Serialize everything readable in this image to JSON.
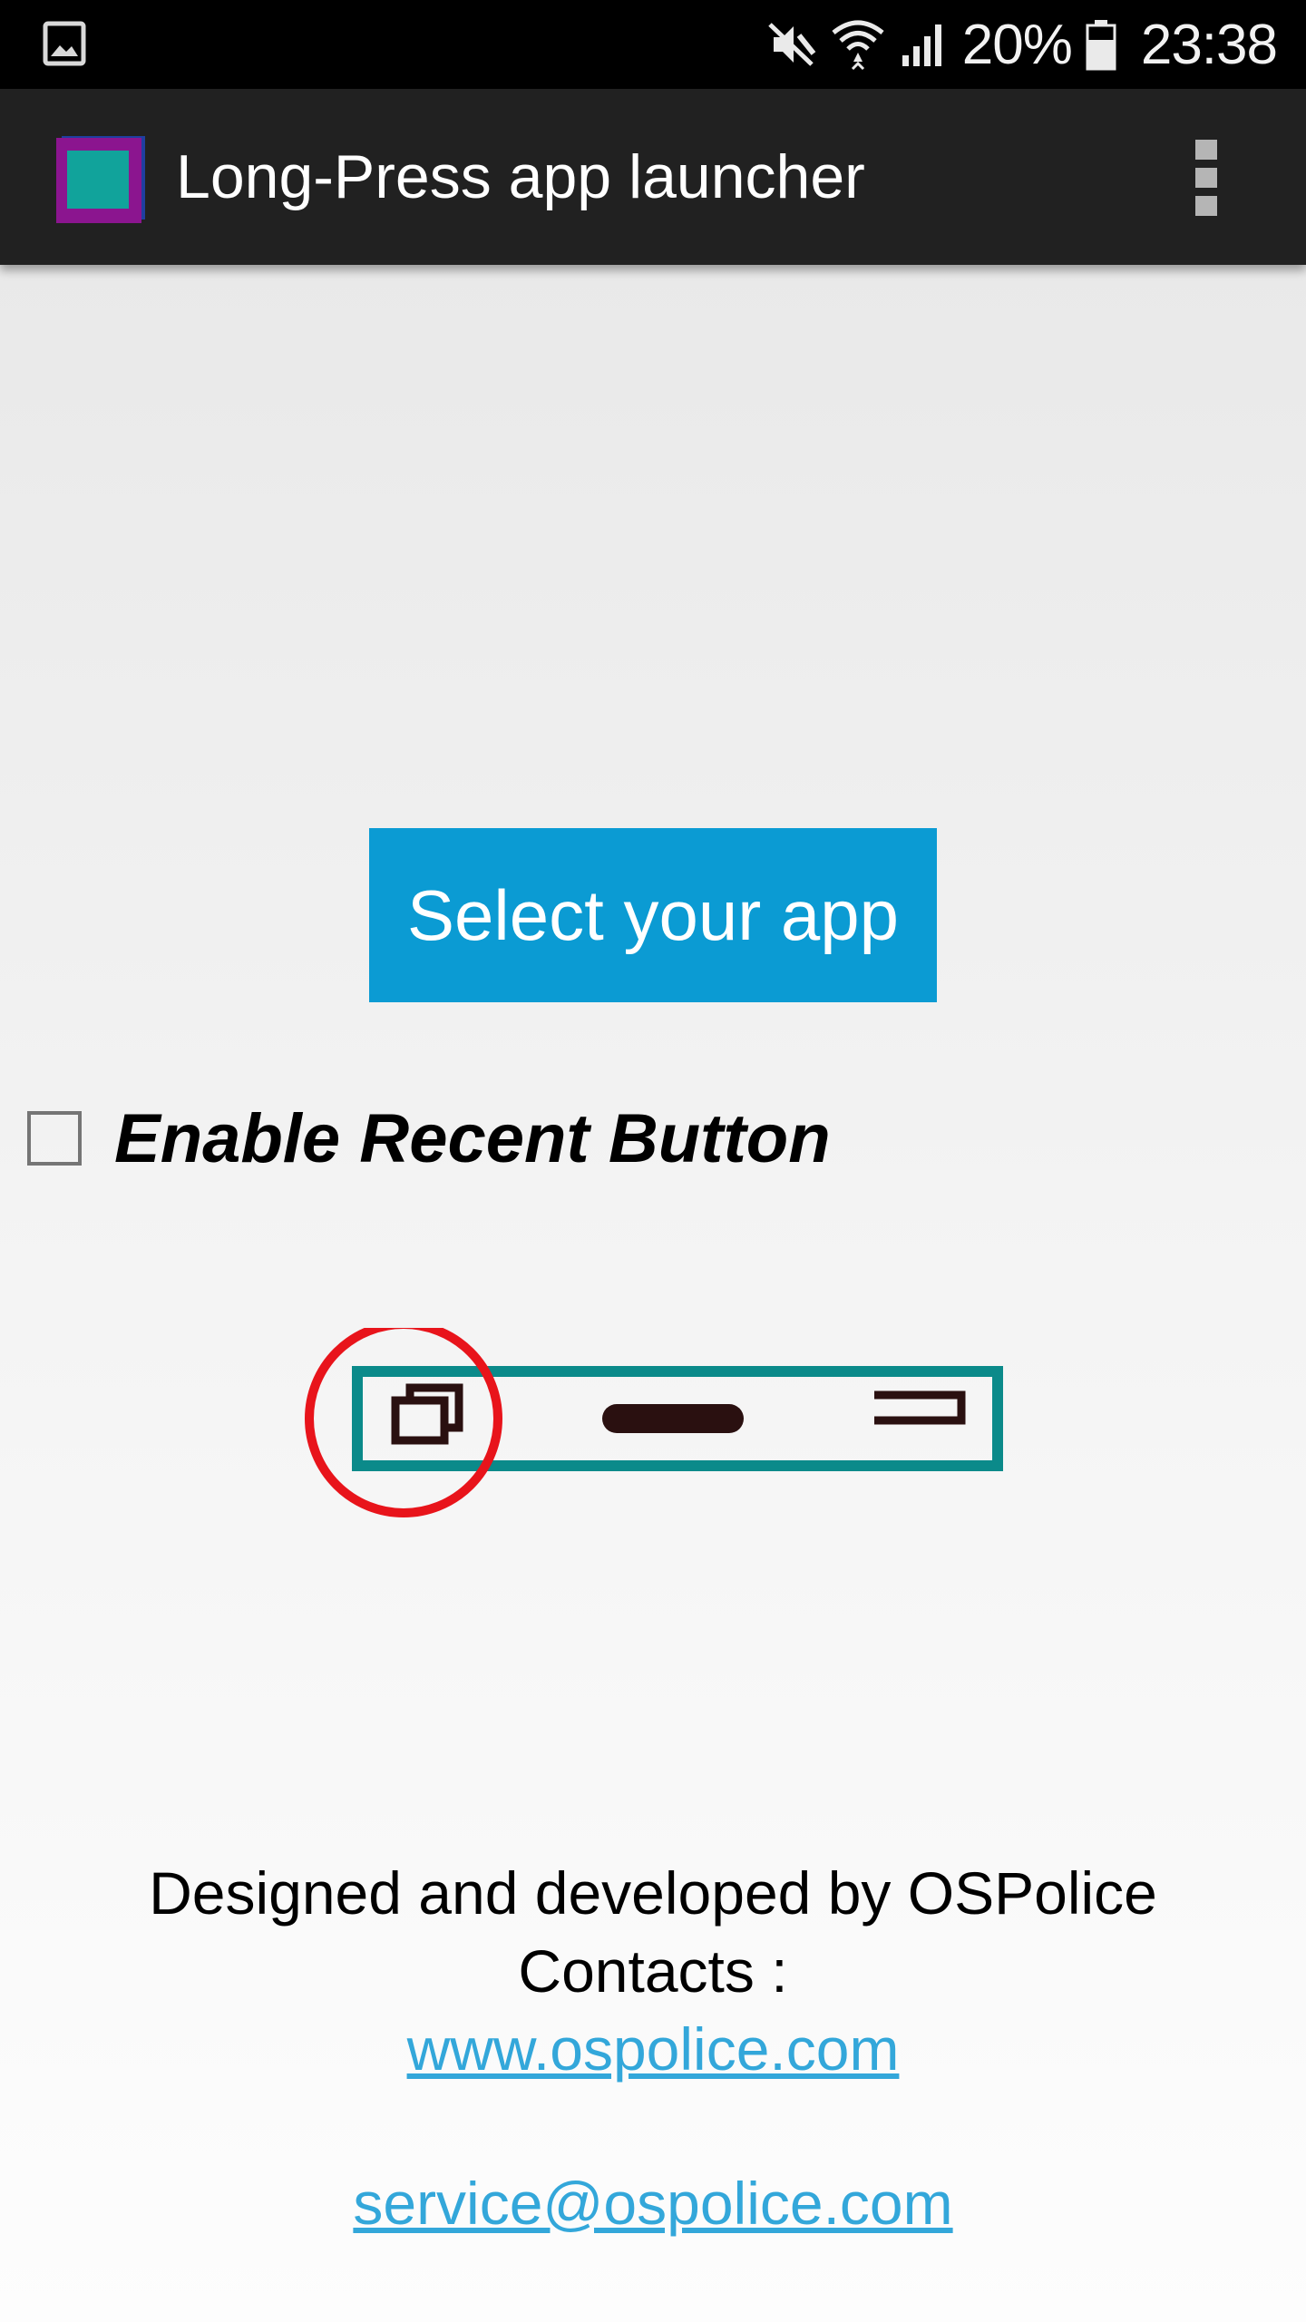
{
  "status_bar": {
    "battery_percent": "20%",
    "time": "23:38",
    "icons": [
      "gallery-notification-icon",
      "muted-speaker-icon",
      "wifi-icon",
      "signal-icon",
      "battery-icon"
    ]
  },
  "app_bar": {
    "title": "Long-Press app launcher",
    "icon": "app-launcher-icon",
    "menu_icon": "overflow-menu-icon"
  },
  "main": {
    "select_button_label": "Select your app",
    "checkbox": {
      "label": "Enable Recent Button",
      "checked": false
    },
    "illustration": {
      "icons": [
        "recent-apps-icon",
        "home-icon",
        "back-icon"
      ],
      "highlight_color": "#e8141b",
      "frame_color": "#0b8a8a"
    }
  },
  "footer": {
    "credit": "Designed and developed by OSPolice",
    "contacts_label": "Contacts :",
    "website": "www.ospolice.com",
    "email": "service@ospolice.com"
  },
  "colors": {
    "accent": "#0b9bd3",
    "link": "#33a7da",
    "app_bar": "#212121"
  }
}
